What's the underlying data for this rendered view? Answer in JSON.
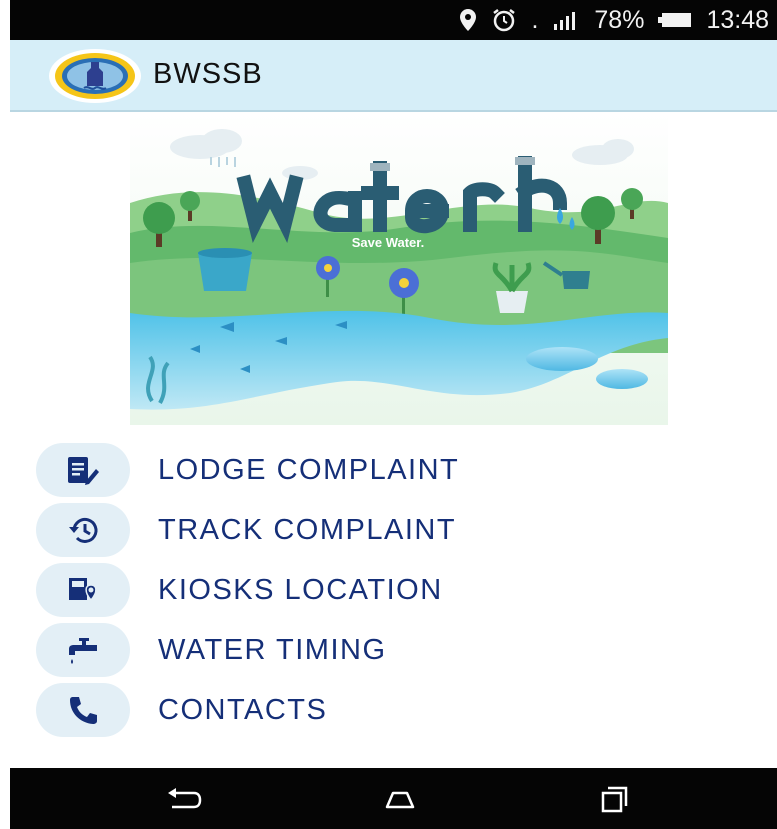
{
  "status_bar": {
    "battery": "78%",
    "time": "13:48",
    "dot": ".",
    "icons": [
      "location-icon",
      "alarm-icon",
      "signal-icon",
      "battery-icon"
    ]
  },
  "app_bar": {
    "title": "BWSSB",
    "logo": "bwssb-emblem-logo"
  },
  "banner": {
    "headline": "water",
    "tagline": "Save Water."
  },
  "menu": {
    "items": [
      {
        "label": "LODGE COMPLAINT",
        "icon": "edit-document-icon"
      },
      {
        "label": "TRACK COMPLAINT",
        "icon": "history-icon"
      },
      {
        "label": "KIOSKS LOCATION",
        "icon": "kiosk-location-icon"
      },
      {
        "label": "WATER TIMING",
        "icon": "tap-icon"
      },
      {
        "label": "CONTACTS",
        "icon": "phone-icon"
      }
    ]
  },
  "nav_bar": {
    "buttons": [
      "back-icon",
      "home-icon",
      "recents-icon"
    ]
  },
  "colors": {
    "menu_text": "#152f78",
    "app_bar_bg": "#d6eef8",
    "icon_bubble": "#e3eff6",
    "status_bar_bg": "#050505"
  }
}
